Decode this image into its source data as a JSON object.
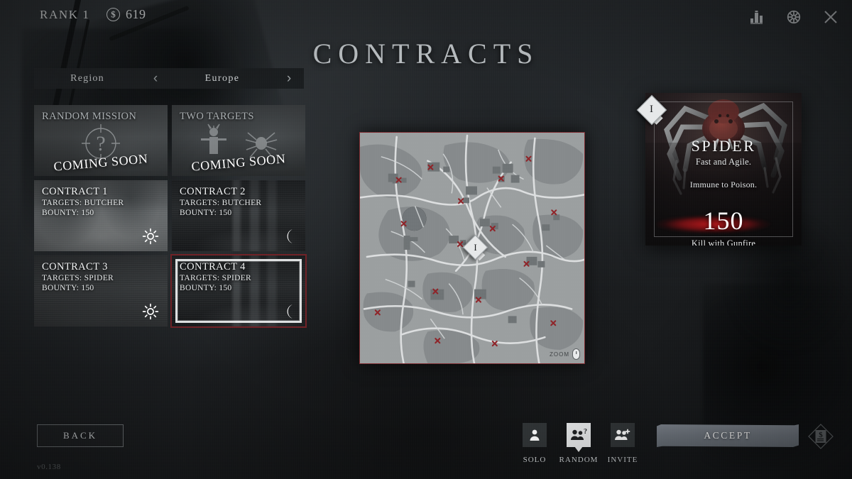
{
  "topbar": {
    "rank_label": "RANK 1",
    "currency_symbol": "$",
    "currency_value": "619",
    "icons": [
      {
        "name": "stats-icon",
        "glyph": "stats"
      },
      {
        "name": "settings-gear-icon",
        "glyph": "gear"
      },
      {
        "name": "close-icon",
        "glyph": "x"
      }
    ]
  },
  "page": {
    "title": "CONTRACTS",
    "version": "v0.138"
  },
  "region": {
    "label": "Region",
    "value": "Europe",
    "prev_arrow": "‹",
    "next_arrow": "›"
  },
  "contracts": [
    {
      "title": "RANDOM MISSION",
      "targets": "",
      "bounty": "",
      "status": "COMING SOON",
      "time_of_day": "",
      "selected": false,
      "locked": true
    },
    {
      "title": "TWO TARGETS",
      "targets": "",
      "bounty": "",
      "status": "COMING SOON",
      "time_of_day": "",
      "selected": false,
      "locked": true
    },
    {
      "title": "CONTRACT 1",
      "targets": "TARGETS: BUTCHER",
      "bounty": "BOUNTY: 150",
      "status": "",
      "time_of_day": "day",
      "selected": false,
      "locked": false
    },
    {
      "title": "CONTRACT 2",
      "targets": "TARGETS: BUTCHER",
      "bounty": "BOUNTY: 150",
      "status": "",
      "time_of_day": "night",
      "selected": false,
      "locked": false
    },
    {
      "title": "CONTRACT 3",
      "targets": "TARGETS: SPIDER",
      "bounty": "BOUNTY: 150",
      "status": "",
      "time_of_day": "day",
      "selected": false,
      "locked": false
    },
    {
      "title": "CONTRACT 4",
      "targets": "TARGETS: SPIDER",
      "bounty": "BOUNTY: 150",
      "status": "",
      "time_of_day": "night",
      "selected": true,
      "locked": false
    }
  ],
  "map": {
    "objective_marker": "I",
    "zoom_hint": "ZOOM",
    "border_color": "#7d2a2f"
  },
  "target_card": {
    "badge": "I",
    "name": "SPIDER",
    "subtitle": "Fast and Agile.",
    "trait": "Immune to Poison.",
    "bounty": "150",
    "condition": "Kill with Gunfire",
    "accent_color": "#c41a1e"
  },
  "footer": {
    "back_label": "BACK",
    "accept_label": "ACCEPT",
    "modes": [
      {
        "label": "SOLO",
        "icon": "single-person-icon",
        "active": false
      },
      {
        "label": "RANDOM",
        "icon": "two-people-question-icon",
        "active": true
      },
      {
        "label": "INVITE",
        "icon": "two-people-plus-icon",
        "active": false
      }
    ],
    "bounty_icon": "bounty-document-icon"
  }
}
